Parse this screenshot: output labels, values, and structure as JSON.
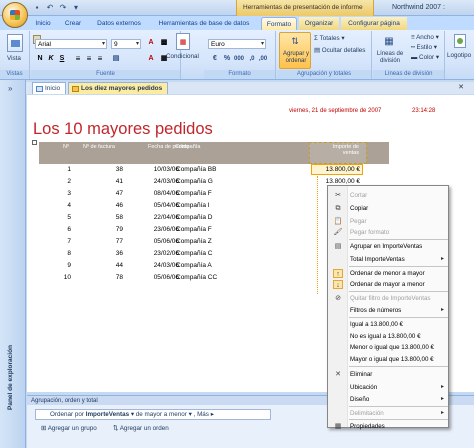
{
  "title_bar": {
    "contextual_tab_set": "Herramientas de presentación de informe",
    "app_title": "Northwind 2007 :"
  },
  "ribbon_tabs": [
    "Inicio",
    "Crear",
    "Datos externos",
    "Herramientas de base de datos",
    "Formato",
    "Organizar",
    "Configurar página"
  ],
  "ribbon": {
    "vistas": {
      "button": "Vista",
      "label": "Vistas"
    },
    "fuente": {
      "font": "Arial",
      "size": "9",
      "label": "Fuente"
    },
    "condicional": "Condicional",
    "formato": {
      "format": "Euro",
      "label": "Formato"
    },
    "agrupacion": {
      "button": "Agrupar y ordenar",
      "totales": "Totales",
      "ocultar": "Ocultar detalles",
      "label": "Agrupación y totales"
    },
    "lineas": {
      "button": "Líneas de división",
      "ancho": "Ancho",
      "estilo": "Estilo",
      "color": "Color",
      "label": "Líneas de división"
    },
    "logotipo": "Logotipo"
  },
  "doc_tabs": [
    "Inicio",
    "Los diez mayores pedidos"
  ],
  "nav_pane": {
    "label": "Panel de exploración"
  },
  "report": {
    "date": "viernes, 21 de septiembre de 2007",
    "time": "23:14:28",
    "title": "Los 10 mayores pedidos",
    "headers": {
      "num": "Nº",
      "factura": "Nº de factura",
      "fecha": "Fecha de pedido",
      "compania": "Compañía",
      "importe": "Importe de ventas"
    },
    "rows": [
      {
        "n": "1",
        "factura": "38",
        "fecha": "10/03/06",
        "compania": "Compañía BB",
        "importe": "13.800,00 €"
      },
      {
        "n": "2",
        "factura": "41",
        "fecha": "24/03/06",
        "compania": "Compañía G",
        "importe": "13.800,00 €"
      },
      {
        "n": "3",
        "factura": "47",
        "fecha": "08/04/06",
        "compania": "Compañía F",
        "importe": ""
      },
      {
        "n": "4",
        "factura": "46",
        "fecha": "05/04/06",
        "compania": "Compañía I",
        "importe": ""
      },
      {
        "n": "5",
        "factura": "58",
        "fecha": "22/04/06",
        "compania": "Compañía D",
        "importe": ""
      },
      {
        "n": "6",
        "factura": "79",
        "fecha": "23/06/06",
        "compania": "Compañía F",
        "importe": ""
      },
      {
        "n": "7",
        "factura": "77",
        "fecha": "05/06/06",
        "compania": "Compañía Z",
        "importe": ""
      },
      {
        "n": "8",
        "factura": "36",
        "fecha": "23/02/06",
        "compania": "Compañía C",
        "importe": ""
      },
      {
        "n": "9",
        "factura": "44",
        "fecha": "24/03/06",
        "compania": "Compañía A",
        "importe": ""
      },
      {
        "n": "10",
        "factura": "78",
        "fecha": "05/06/06",
        "compania": "Compañía CC",
        "importe": ""
      }
    ]
  },
  "grouping": {
    "header": "Agrupación, orden y total",
    "sort_prefix": "Ordenar por",
    "sort_field": "ImporteVentas",
    "sort_order": "de mayor a menor",
    "more": "Más",
    "add_group": "Agregar un grupo",
    "add_sort": "Agregar un orden"
  },
  "context_menu": [
    {
      "label": "Cortar",
      "disabled": true,
      "icon": "cut-icon"
    },
    {
      "label": "Copiar",
      "disabled": false,
      "icon": "copy-icon"
    },
    {
      "label": "Pegar",
      "disabled": true,
      "icon": "paste-icon"
    },
    {
      "label": "Pegar formato",
      "disabled": true,
      "icon": "paste-format-icon"
    },
    {
      "label": "Agrupar en ImporteVentas",
      "disabled": false,
      "icon": "group-icon"
    },
    {
      "label": "Total ImporteVentas",
      "disabled": false,
      "icon": ""
    },
    {
      "label": "Ordenar de menor a mayor",
      "disabled": false,
      "icon": "sort-asc-icon"
    },
    {
      "label": "Ordenar de mayor a menor",
      "disabled": false,
      "icon": "sort-desc-icon"
    },
    {
      "label": "Quitar filtro de ImporteVentas",
      "disabled": true,
      "icon": "remove-filter-icon"
    },
    {
      "label": "Filtros de números",
      "disabled": false,
      "icon": ""
    },
    {
      "label": "Igual a 13.800,00 €",
      "disabled": false,
      "icon": ""
    },
    {
      "label": "No es igual a 13.800,00 €",
      "disabled": false,
      "icon": ""
    },
    {
      "label": "Menor o igual que 13.800,00 €",
      "disabled": false,
      "icon": ""
    },
    {
      "label": "Mayor o igual que 13.800,00 €",
      "disabled": false,
      "icon": ""
    },
    {
      "label": "Eliminar",
      "disabled": false,
      "icon": "delete-icon"
    },
    {
      "label": "Ubicación",
      "disabled": false,
      "icon": ""
    },
    {
      "label": "Diseño",
      "disabled": false,
      "icon": ""
    },
    {
      "label": "Delimitación",
      "disabled": true,
      "icon": ""
    },
    {
      "label": "Propiedades",
      "disabled": false,
      "icon": "properties-icon"
    }
  ]
}
